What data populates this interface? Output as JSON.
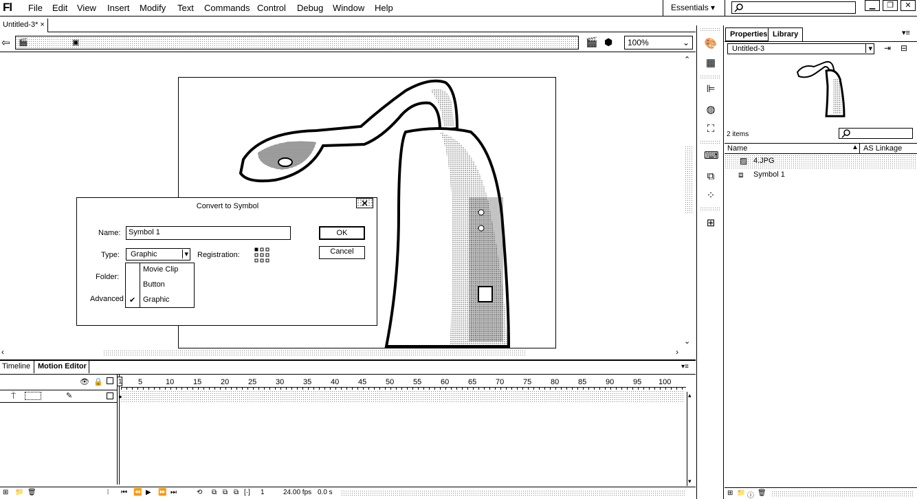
{
  "app": {
    "logo": "Fl",
    "menu": [
      "File",
      "Edit",
      "View",
      "Insert",
      "Modify",
      "Text",
      "Commands",
      "Control",
      "Debug",
      "Window",
      "Help"
    ],
    "workspace": "Essentials"
  },
  "document": {
    "tab": "Untitled-3*",
    "zoom": "100%"
  },
  "dialog": {
    "title": "Convert to Symbol",
    "name_label": "Name:",
    "name_value": "Symbol 1",
    "type_label": "Type:",
    "type_value": "Graphic",
    "registration_label": "Registration:",
    "folder_label": "Folder:",
    "advanced_label": "Advanced",
    "ok": "OK",
    "cancel": "Cancel",
    "type_options": [
      {
        "label": "Movie Clip",
        "checked": false
      },
      {
        "label": "Button",
        "checked": false
      },
      {
        "label": "Graphic",
        "checked": true
      }
    ]
  },
  "panel": {
    "tabs": [
      "Properties",
      "Library"
    ],
    "active_tab": "Library",
    "library_doc": "Untitled-3",
    "items_count": "2 items",
    "col_name": "Name",
    "col_linkage": "AS Linkage",
    "items": [
      {
        "name": "4.JPG",
        "icon": "bitmap-icon",
        "selected": true
      },
      {
        "name": "Symbol 1",
        "icon": "graphic-symbol-icon",
        "selected": false
      }
    ]
  },
  "timeline": {
    "tabs": [
      "Timeline",
      "Motion Editor"
    ],
    "frame_numbers": [
      "1",
      "5",
      "10",
      "15",
      "20",
      "25",
      "30",
      "35",
      "40",
      "45",
      "50",
      "55",
      "60",
      "65",
      "70",
      "75",
      "80",
      "85",
      "90",
      "95",
      "100"
    ],
    "current_frame": "1",
    "fps": "24.00 fps",
    "time": "0.0 s"
  }
}
